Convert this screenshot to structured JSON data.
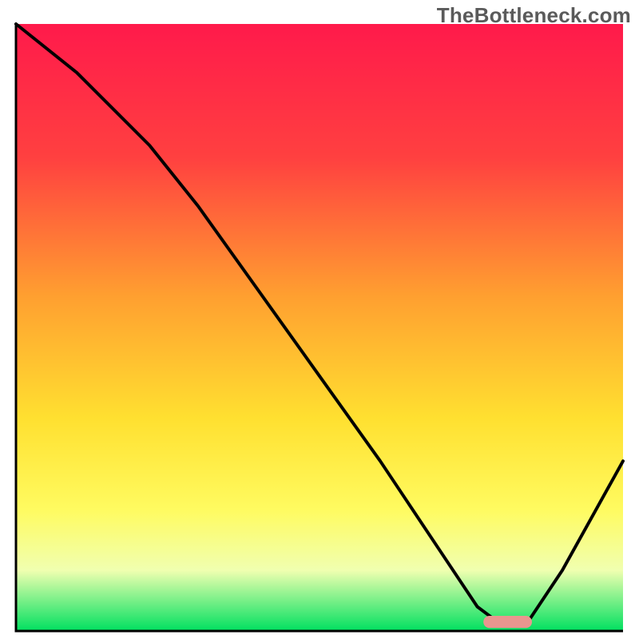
{
  "watermark": "TheBottleneck.com",
  "chart_data": {
    "type": "line",
    "title": "",
    "xlabel": "",
    "ylabel": "",
    "xlim": [
      0,
      100
    ],
    "ylim": [
      0,
      100
    ],
    "background_gradient": {
      "stops": [
        {
          "y": 0,
          "color": "#ff1a4b"
        },
        {
          "y": 22,
          "color": "#ff4040"
        },
        {
          "y": 45,
          "color": "#ffa030"
        },
        {
          "y": 65,
          "color": "#ffe030"
        },
        {
          "y": 80,
          "color": "#fffb60"
        },
        {
          "y": 90,
          "color": "#f0ffb0"
        },
        {
          "y": 100,
          "color": "#00e060"
        }
      ]
    },
    "series": [
      {
        "name": "bottleneck-curve",
        "color": "#000000",
        "x": [
          0,
          10,
          22,
          30,
          40,
          50,
          60,
          70,
          76,
          80,
          84,
          90,
          100
        ],
        "y": [
          100,
          92,
          80,
          70,
          56,
          42,
          28,
          13,
          4,
          1,
          1,
          10,
          28
        ]
      }
    ],
    "marker": {
      "name": "optimal-range",
      "color": "#e9968f",
      "shape": "pill",
      "x_start": 77,
      "x_end": 85,
      "y": 1.5,
      "height_pct": 2.0
    },
    "axes": {
      "show_ticks": false,
      "show_grid": false,
      "border_color": "#000000",
      "border_width": 3
    }
  }
}
